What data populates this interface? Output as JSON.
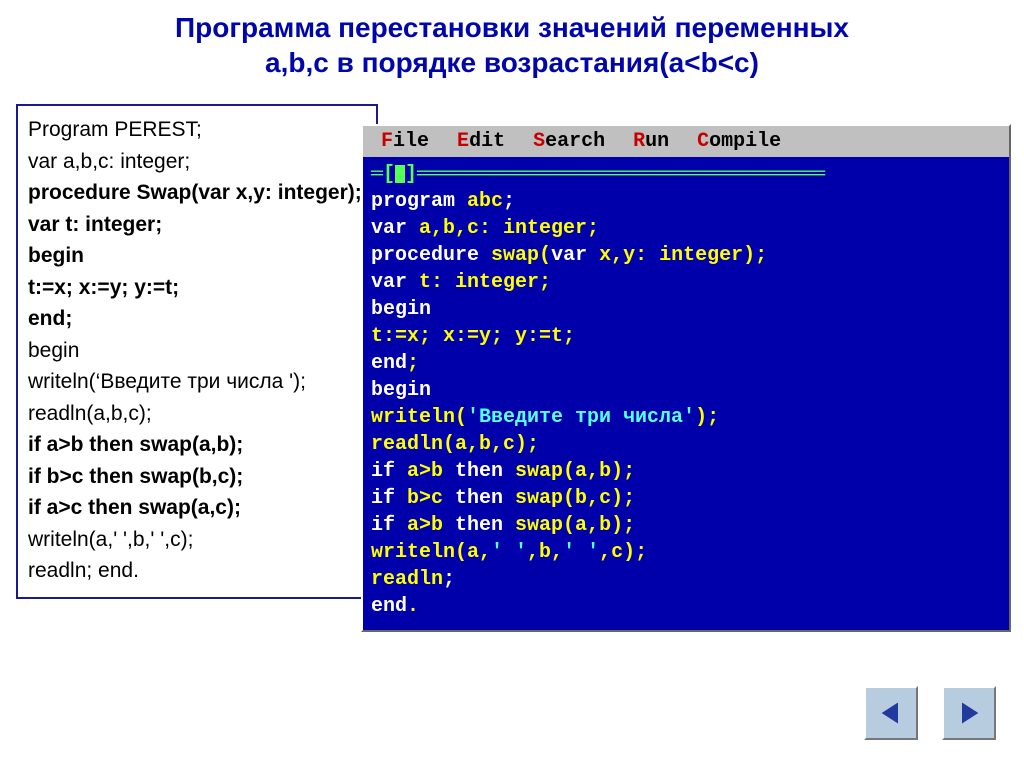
{
  "title_line1": "Программа перестановки значений переменных",
  "title_line2": "a,b,c в порядке возрастания(a<b<c)",
  "left_code": [
    {
      "t": "Program PEREST;",
      "b": false
    },
    {
      "t": "var a,b,c: integer;",
      "b": false
    },
    {
      "t": "procedure Swap(var x,y: integer);",
      "b": true
    },
    {
      "t": "var t: integer;",
      "b": true
    },
    {
      "t": "begin",
      "b": true
    },
    {
      "t": "t:=x; x:=y; y:=t;",
      "b": true
    },
    {
      "t": "end;",
      "b": true
    },
    {
      "t": "begin",
      "b": false
    },
    {
      "t": "writeln(‘Введите три числа ');",
      "b": false
    },
    {
      "t": "readln(a,b,c);",
      "b": false
    },
    {
      "t": "if a>b then swap(a,b);",
      "b": true
    },
    {
      "t": "if b>c then swap(b,c);",
      "b": true
    },
    {
      "t": "if a>c then swap(a,c);",
      "b": true
    },
    {
      "t": "writeln(a,' ',b,' ',c);",
      "b": false
    },
    {
      "t": "readln;  end.",
      "b": false
    }
  ],
  "menu": {
    "file": {
      "hot": "F",
      "rest": "ile"
    },
    "edit": {
      "hot": "E",
      "rest": "dit"
    },
    "search": {
      "hot": "S",
      "rest": "earch"
    },
    "run": {
      "hot": "R",
      "rest": "un"
    },
    "compile": {
      "hot": "C",
      "rest": "ompile"
    }
  },
  "ide_code": {
    "l1": {
      "a": "program",
      "b": " abc",
      "c": ";"
    },
    "l2": {
      "a": "var",
      "b": " a,b,c: integer;"
    },
    "l3": {
      "a": "procedure",
      "b": " swap",
      "c": "(",
      "d": "var",
      "e": " x,y: integer);"
    },
    "l4": {
      "a": "var",
      "b": " t: integer;"
    },
    "l5": "begin",
    "l6": "t:=x; x:=y; y:=t;",
    "l7": {
      "a": "end",
      "b": ";"
    },
    "l8": "begin",
    "l9": {
      "a": "writeln(",
      "b": "'Введите три числа'",
      "c": ");"
    },
    "l10": "readln(a,b,c);",
    "l11": {
      "a": "if",
      "b": " a>b ",
      "c": "then",
      "d": " swap(a,b);"
    },
    "l12": {
      "a": "if",
      "b": " b>c ",
      "c": "then",
      "d": " swap(b,c);"
    },
    "l13": {
      "a": "if",
      "b": " a>b ",
      "c": "then",
      "d": " swap(a,b);"
    },
    "l14": {
      "a": "writeln(a,",
      "b": "' '",
      "c": ",b,",
      "d": "' '",
      "e": ",c);"
    },
    "l15": {
      "a": "readln",
      "b": ";"
    },
    "l16": {
      "a": "end",
      "b": "."
    }
  }
}
